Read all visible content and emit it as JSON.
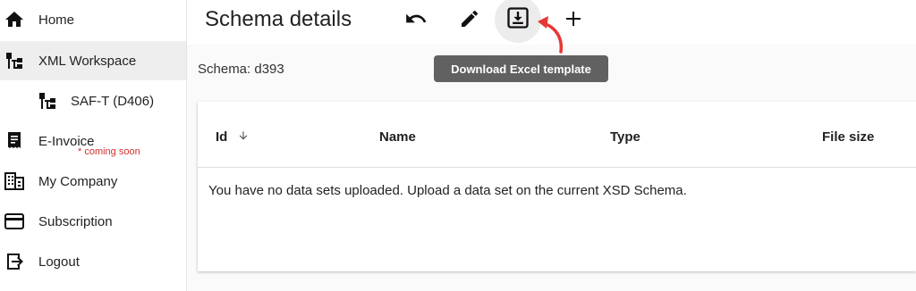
{
  "sidebar": {
    "items": [
      {
        "label": "Home",
        "icon": "home-icon"
      },
      {
        "label": "XML Workspace",
        "icon": "tree-icon"
      },
      {
        "label": "SAF-T (D406)",
        "icon": "tree-icon"
      },
      {
        "label": "E-Invoice",
        "icon": "receipt-icon",
        "note": "* coming soon"
      },
      {
        "label": "My Company",
        "icon": "building-icon"
      },
      {
        "label": "Subscription",
        "icon": "credit-card-icon"
      },
      {
        "label": "Logout",
        "icon": "logout-icon"
      }
    ]
  },
  "header": {
    "title": "Schema details",
    "tooltip": "Download Excel template",
    "tools": [
      "undo-icon",
      "edit-icon",
      "download-icon",
      "add-icon"
    ]
  },
  "main": {
    "schema_label": "Schema: d393",
    "table": {
      "columns": [
        "Id",
        "Name",
        "Type",
        "File size"
      ],
      "empty_message": "You have no data sets uploaded. Upload a data set on the current XSD Schema."
    }
  },
  "colors": {
    "accent_arrow": "#e53935",
    "active_bg": "#eeeeee",
    "tooltip_bg": "#616161",
    "coming_soon": "#d32f2f"
  }
}
